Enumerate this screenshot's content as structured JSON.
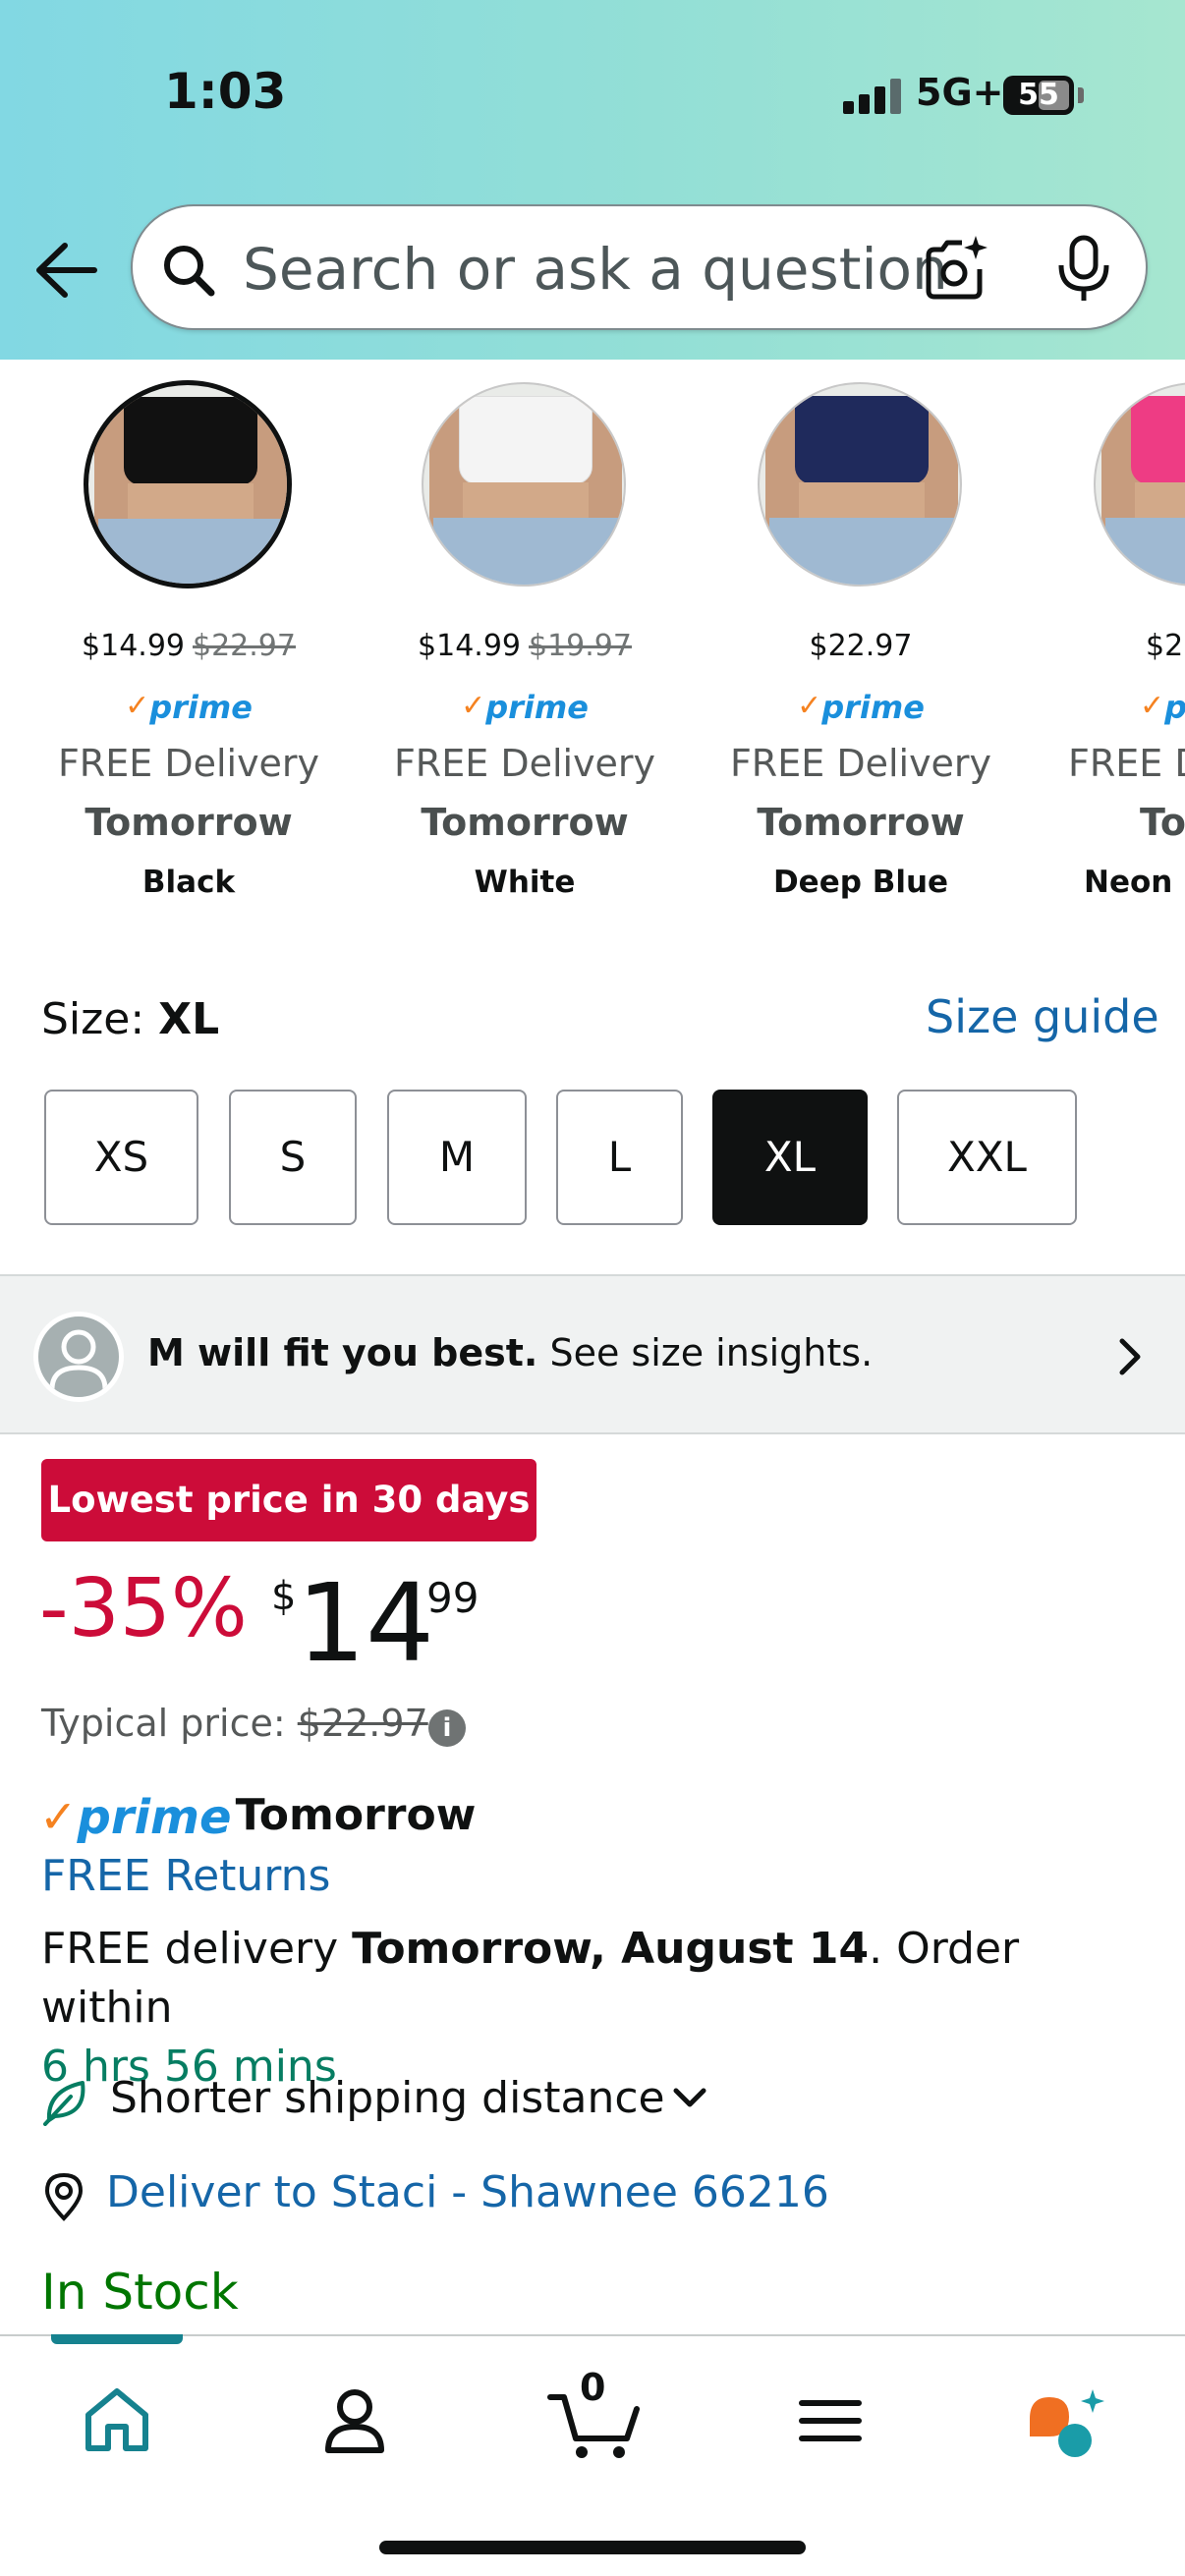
{
  "status_bar": {
    "time": "1:03",
    "network": "5G+",
    "battery": "55"
  },
  "search": {
    "placeholder": "Search or ask a question"
  },
  "variants": [
    {
      "price": "$14.99",
      "list_price": "$22.97",
      "prime": "prime",
      "delivery": "FREE Delivery",
      "when": "Tomorrow",
      "color": "Black",
      "swatch": "#111111",
      "selected": true
    },
    {
      "price": "$14.99",
      "list_price": "$19.97",
      "prime": "prime",
      "delivery": "FREE Delivery",
      "when": "Tomorrow",
      "color": "White",
      "swatch": "#f4f4f4",
      "selected": false
    },
    {
      "price": "$22.97",
      "list_price": "",
      "prime": "prime",
      "delivery": "FREE Delivery",
      "when": "Tomorrow",
      "color": "Deep Blue",
      "swatch": "#1f2a5c",
      "selected": false
    },
    {
      "price": "$2",
      "list_price": "",
      "prime": "p",
      "delivery": "FREE D",
      "when": "Tomo",
      "color": "Neon R",
      "swatch": "#ee3c84",
      "selected": false
    }
  ],
  "size": {
    "label": "Size: ",
    "selected": "XL",
    "guide_link": "Size guide",
    "options": [
      "XS",
      "S",
      "M",
      "L",
      "XL",
      "XXL"
    ]
  },
  "fit": {
    "bold": "M will fit you best.",
    "rest": " See size insights."
  },
  "pricing": {
    "badge": "Lowest price in 30 days",
    "discount": "-35%",
    "currency": "$",
    "whole": "14",
    "fraction": "99",
    "typical_label": "Typical price: ",
    "typical_value": "$22.97",
    "info": "i"
  },
  "delivery": {
    "prime_word": "prime",
    "prime_when": "Tomorrow",
    "free_returns": "FREE Returns",
    "line_start": "FREE delivery ",
    "line_bold": "Tomorrow, August 14",
    "line_end": ". Order within ",
    "countdown": "6 hrs 56 mins",
    "shipping": "Shorter shipping distance",
    "deliver_to": "Deliver to Staci - Shawnee 66216",
    "stock": "In Stock"
  },
  "nav": {
    "cart_count": "0"
  },
  "colors": {
    "link": "#1566a8",
    "deal_red": "#cc0c39",
    "in_stock": "#007600",
    "countdown": "#067d62",
    "prime_blue": "#1a8fdc",
    "accent_teal": "#16828f"
  }
}
